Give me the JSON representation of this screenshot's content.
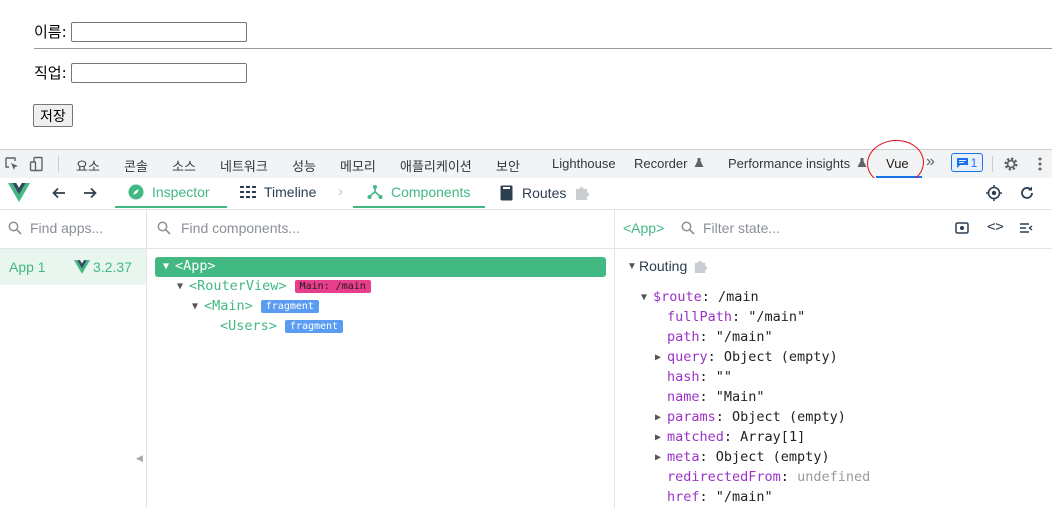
{
  "form": {
    "name_label": "이름:",
    "name_value": "",
    "job_label": "직업:",
    "job_value": "",
    "save_label": "저장"
  },
  "devtools": {
    "tabs": [
      "요소",
      "콘솔",
      "소스",
      "네트워크",
      "성능",
      "메모리",
      "애플리케이션",
      "보안",
      "Lighthouse",
      "Recorder",
      "Performance insights",
      "Vue"
    ],
    "active_tab": "Vue",
    "more_label": "»",
    "message_count": "1"
  },
  "vue": {
    "nav": {
      "inspector": "Inspector",
      "timeline": "Timeline",
      "components": "Components",
      "routes": "Routes"
    },
    "apps": {
      "search_placeholder": "Find apps...",
      "items": [
        {
          "label": "App 1",
          "version": "3.2.37"
        }
      ]
    },
    "components": {
      "search_placeholder": "Find components...",
      "tree": {
        "app": "<App>",
        "router_view": "<RouterView>",
        "router_view_badge": "Main: /main",
        "main": "<Main>",
        "main_badge": "fragment",
        "users": "<Users>",
        "users_badge": "fragment"
      }
    },
    "state": {
      "selected": "<App>",
      "filter_placeholder": "Filter state...",
      "section": "Routing",
      "route_key": "$route",
      "route_value": "/main",
      "props": [
        {
          "key": "fullPath",
          "value": "\"/main\"",
          "expandable": false,
          "kind": "str"
        },
        {
          "key": "path",
          "value": "\"/main\"",
          "expandable": false,
          "kind": "str"
        },
        {
          "key": "query",
          "value": "Object (empty)",
          "expandable": true,
          "kind": "str"
        },
        {
          "key": "hash",
          "value": "\"\"",
          "expandable": false,
          "kind": "str"
        },
        {
          "key": "name",
          "value": "\"Main\"",
          "expandable": false,
          "kind": "str"
        },
        {
          "key": "params",
          "value": "Object (empty)",
          "expandable": true,
          "kind": "str"
        },
        {
          "key": "matched",
          "value": "Array[1]",
          "expandable": true,
          "kind": "str"
        },
        {
          "key": "meta",
          "value": "Object (empty)",
          "expandable": true,
          "kind": "str"
        },
        {
          "key": "redirectedFrom",
          "value": "undefined",
          "expandable": false,
          "kind": "undef"
        },
        {
          "key": "href",
          "value": "\"/main\"",
          "expandable": false,
          "kind": "str"
        }
      ]
    }
  },
  "colors": {
    "vue_green": "#42b883",
    "pink_badge": "#e93e8c",
    "blue_badge": "#5b9cf3",
    "key_purple": "#9b33c7",
    "annotation_red": "#e0101a"
  }
}
